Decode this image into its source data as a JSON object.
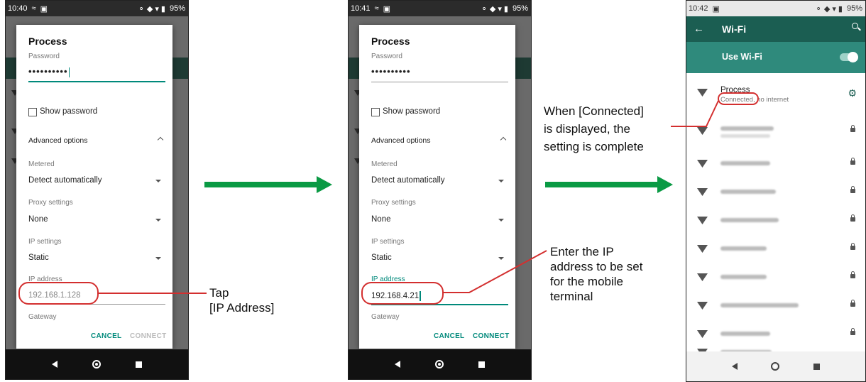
{
  "screens": [
    {
      "status_time": "10:40",
      "battery": "95%",
      "dialog": {
        "title": "Process",
        "password_label": "Password",
        "password_value": "••••••••••",
        "show_password": "Show password",
        "advanced": "Advanced options",
        "metered_label": "Metered",
        "metered_value": "Detect automatically",
        "proxy_label": "Proxy settings",
        "proxy_value": "None",
        "ip_settings_label": "IP settings",
        "ip_settings_value": "Static",
        "ip_address_label": "IP address",
        "ip_address_value": "192.168.1.128",
        "gateway_label": "Gateway",
        "cancel": "CANCEL",
        "connect": "CONNECT"
      }
    },
    {
      "status_time": "10:41",
      "battery": "95%",
      "dialog": {
        "title": "Process",
        "password_label": "Password",
        "password_value": "••••••••••",
        "show_password": "Show password",
        "advanced": "Advanced options",
        "metered_label": "Metered",
        "metered_value": "Detect automatically",
        "proxy_label": "Proxy settings",
        "proxy_value": "None",
        "ip_settings_label": "IP settings",
        "ip_settings_value": "Static",
        "ip_address_label": "IP address",
        "ip_address_value": "192.168.4.21",
        "gateway_label": "Gateway",
        "cancel": "CANCEL",
        "connect": "CONNECT"
      }
    },
    {
      "status_time": "10:42",
      "battery": "95%",
      "wifi": {
        "back": "←",
        "title": "Wi-Fi",
        "use_wifi": "Use Wi-Fi",
        "network_name": "Process",
        "network_status": "Connected, no internet"
      }
    }
  ],
  "annotations": {
    "tap_line1": "Tap",
    "tap_line2": "[IP Address]",
    "enter_ip": [
      "Enter the IP",
      "address to be set",
      "for the mobile",
      "terminal"
    ],
    "connected": [
      "When [Connected]",
      "is displayed, the",
      "setting is complete"
    ]
  },
  "colors": {
    "accent": "#00897b",
    "callout": "#d32f2f",
    "arrow": "#0a9a44",
    "wifi_header": "#1b5e52",
    "wifi_toggle_bar": "#2f8a7c"
  }
}
